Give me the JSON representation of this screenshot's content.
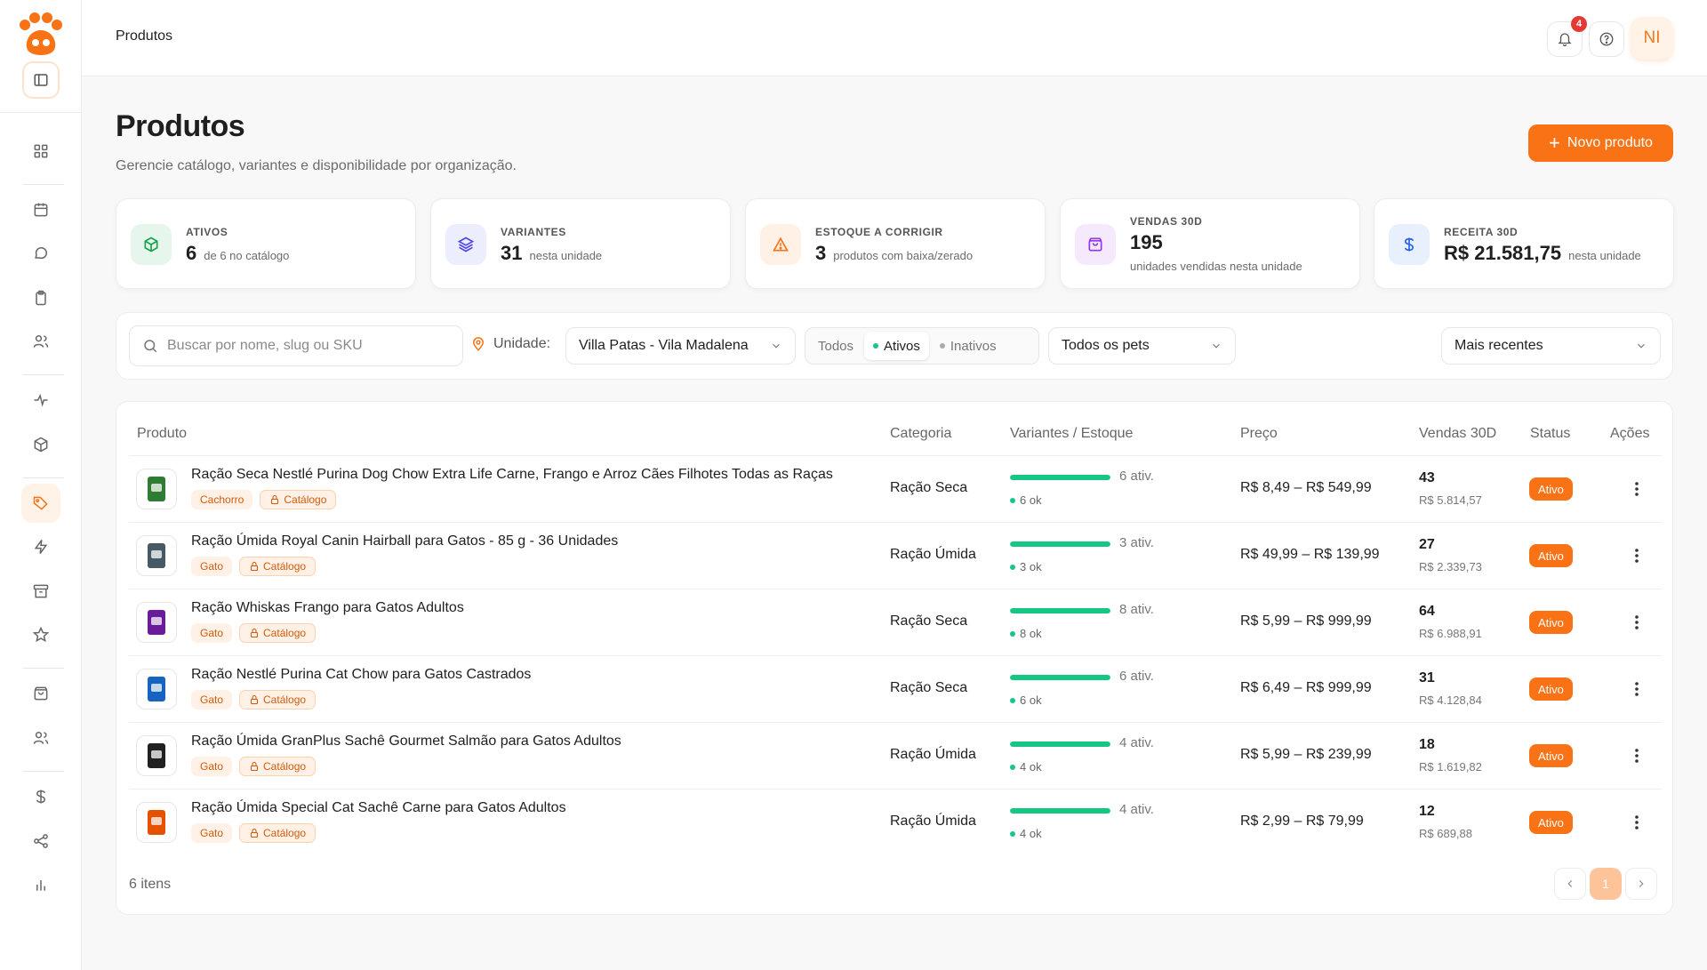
{
  "header": {
    "title": "Produtos",
    "notifications_count": "4",
    "avatar_initials": "NI"
  },
  "page": {
    "title": "Produtos",
    "subtitle": "Gerencie catálogo, variantes e disponibilidade por organização.",
    "new_button_label": "Novo produto"
  },
  "kpis": [
    {
      "label": "ATIVOS",
      "value": "6",
      "sub": "de 6 no catálogo",
      "icon": "box-icon",
      "color": "#16a34a"
    },
    {
      "label": "VARIANTES",
      "value": "31",
      "sub": "nesta unidade",
      "icon": "layers-icon",
      "color": "#4f46e5"
    },
    {
      "label": "ESTOQUE A CORRIGIR",
      "value": "3",
      "sub": "produtos com baixa/zerado",
      "icon": "warning-icon",
      "color": "#f97316"
    },
    {
      "label": "VENDAS 30D",
      "value": "195",
      "sub": "unidades vendidas nesta unidade",
      "icon": "shopping-bag-icon",
      "color": "#9333ea"
    },
    {
      "label": "RECEITA 30D",
      "value": "R$ 21.581,75",
      "sub": "nesta unidade",
      "icon": "dollar-icon",
      "color": "#2563eb"
    }
  ],
  "filters": {
    "search_placeholder": "Buscar por nome, slug ou SKU",
    "unit_label": "Unidade:",
    "unit_value": "Villa Patas - Vila Madalena",
    "status_options": [
      "Todos",
      "Ativos",
      "Inativos"
    ],
    "status_selected": "Ativos",
    "pets_value": "Todos os pets",
    "sort_value": "Mais recentes"
  },
  "table": {
    "columns": [
      "Produto",
      "Categoria",
      "Variantes / Estoque",
      "Preço",
      "Vendas 30D",
      "Status",
      "Ações"
    ],
    "rows": [
      {
        "name": "Ração Seca Nestlé Purina Dog Chow Extra Life Carne, Frango e Arroz Cães Filhotes Todas as Raças",
        "pet": "Cachorro",
        "catalog": "Catálogo",
        "category": "Ração Seca",
        "variants": "6 ativ.",
        "ok": "6 ok",
        "stock_fill": 1.0,
        "price": "R$ 8,49 – R$ 549,99",
        "sales": "43",
        "revenue": "R$ 5.814,57",
        "status": "Ativo",
        "thumb_color": "#2e7d32"
      },
      {
        "name": "Ração Úmida Royal Canin Hairball para Gatos - 85 g - 36 Unidades",
        "pet": "Gato",
        "catalog": "Catálogo",
        "category": "Ração Úmida",
        "variants": "3 ativ.",
        "ok": "3 ok",
        "stock_fill": 1.0,
        "price": "R$ 49,99 – R$ 139,99",
        "sales": "27",
        "revenue": "R$ 2.339,73",
        "status": "Ativo",
        "thumb_color": "#455a64"
      },
      {
        "name": "Ração Whiskas Frango para Gatos Adultos",
        "pet": "Gato",
        "catalog": "Catálogo",
        "category": "Ração Seca",
        "variants": "8 ativ.",
        "ok": "8 ok",
        "stock_fill": 1.0,
        "price": "R$ 5,99 – R$ 999,99",
        "sales": "64",
        "revenue": "R$ 6.988,91",
        "status": "Ativo",
        "thumb_color": "#6a1b9a"
      },
      {
        "name": "Ração Nestlé Purina Cat Chow para Gatos Castrados",
        "pet": "Gato",
        "catalog": "Catálogo",
        "category": "Ração Seca",
        "variants": "6 ativ.",
        "ok": "6 ok",
        "stock_fill": 1.0,
        "price": "R$ 6,49 – R$ 999,99",
        "sales": "31",
        "revenue": "R$ 4.128,84",
        "status": "Ativo",
        "thumb_color": "#1565c0"
      },
      {
        "name": "Ração Úmida GranPlus Sachê Gourmet Salmão para Gatos Adultos",
        "pet": "Gato",
        "catalog": "Catálogo",
        "category": "Ração Úmida",
        "variants": "4 ativ.",
        "ok": "4 ok",
        "stock_fill": 1.0,
        "price": "R$ 5,99 – R$ 239,99",
        "sales": "18",
        "revenue": "R$ 1.619,82",
        "status": "Ativo",
        "thumb_color": "#212121"
      },
      {
        "name": "Ração Úmida Special Cat Sachê Carne para Gatos Adultos",
        "pet": "Gato",
        "catalog": "Catálogo",
        "category": "Ração Úmida",
        "variants": "4 ativ.",
        "ok": "4 ok",
        "stock_fill": 1.0,
        "price": "R$ 2,99 – R$ 79,99",
        "sales": "12",
        "revenue": "R$ 689,88",
        "status": "Ativo",
        "thumb_color": "#e65100"
      }
    ]
  },
  "footer": {
    "items_count": "6 itens",
    "current_page": "1"
  },
  "colors": {
    "accent": "#f97316",
    "success": "#16c784"
  }
}
